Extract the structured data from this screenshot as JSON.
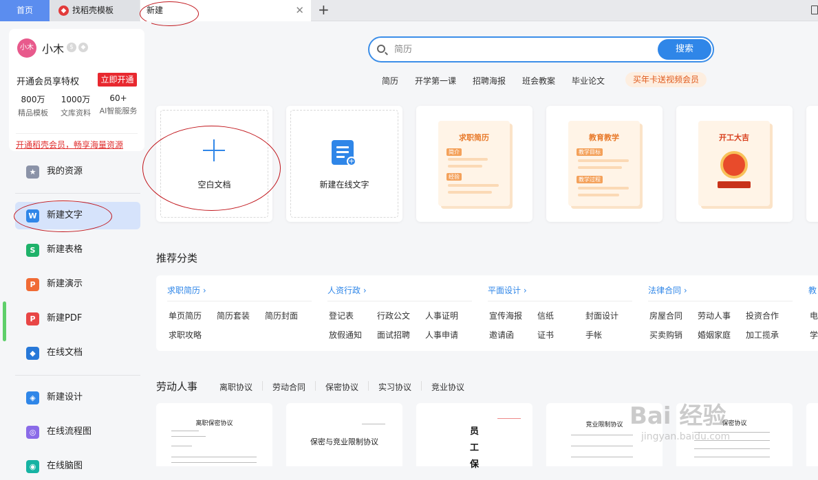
{
  "tabs": {
    "home": "首页",
    "template": "找稻壳模板",
    "new": "新建"
  },
  "user": {
    "avatar_text": "小木",
    "name": "小木",
    "vip_text": "开通会员享特权",
    "vip_button": "立即开通",
    "stats": [
      {
        "value": "800万",
        "label": "精品模板"
      },
      {
        "value": "1000万",
        "label": "文库资料"
      },
      {
        "value": "60+",
        "label": "AI智能服务"
      }
    ],
    "vip_link": "开通稻壳会员，畅享海量资源"
  },
  "sidebar": {
    "items": [
      {
        "label": "我的资源",
        "icon": "star-icon"
      },
      {
        "label": "新建文字",
        "icon": "w-icon"
      },
      {
        "label": "新建表格",
        "icon": "s-icon"
      },
      {
        "label": "新建演示",
        "icon": "p-icon"
      },
      {
        "label": "新建PDF",
        "icon": "pdf-icon"
      },
      {
        "label": "在线文档",
        "icon": "cloud-doc-icon"
      },
      {
        "label": "新建设计",
        "icon": "design-icon"
      },
      {
        "label": "在线流程图",
        "icon": "flow-icon"
      },
      {
        "label": "在线脑图",
        "icon": "mind-icon"
      }
    ],
    "colors": {
      "w": "#2f86e8",
      "s": "#1fb26a",
      "p": "#f06b35",
      "pdf": "#e84646"
    }
  },
  "search": {
    "placeholder": "简历",
    "button": "搜索"
  },
  "hot_tags": [
    "简历",
    "开学第一课",
    "招聘海报",
    "班会教案",
    "毕业论文"
  ],
  "promo": "买年卡送视频会员",
  "templates": [
    {
      "label": "空白文档"
    },
    {
      "label": "新建在线文字"
    },
    {
      "title": "求职简历",
      "tag1": "简介",
      "tag2": "经验"
    },
    {
      "title": "教育教学",
      "tag1": "教学目标",
      "tag2": "教学过程"
    },
    {
      "title": "开工大吉"
    }
  ],
  "recommend_title": "推荐分类",
  "categories": [
    {
      "head": "求职简历 ›",
      "items": [
        "单页简历",
        "简历套装",
        "简历封面",
        "求职攻略"
      ]
    },
    {
      "head": "人资行政 ›",
      "items": [
        "登记表",
        "行政公文",
        "人事证明",
        "放假通知",
        "面试招聘",
        "人事申请"
      ]
    },
    {
      "head": "平面设计 ›",
      "items": [
        "宣传海报",
        "信纸",
        "封面设计",
        "邀请函",
        "证书",
        "手帐"
      ]
    },
    {
      "head": "法律合同 ›",
      "items": [
        "房屋合同",
        "劳动人事",
        "投资合作",
        "买卖购销",
        "婚姻家庭",
        "加工揽承"
      ]
    },
    {
      "head": "教",
      "items": [
        "电",
        "学"
      ]
    }
  ],
  "labor": {
    "title": "劳动人事",
    "tabs": [
      "离职协议",
      "劳动合同",
      "保密协议",
      "实习协议",
      "竞业协议"
    ],
    "docs": [
      "离职保密协议",
      "保密与竞业限制协议",
      "员工保",
      "竞业限制协议",
      "保密协议"
    ]
  },
  "watermark": {
    "main": "Bai 经验",
    "sub": "jingyan.baidu.com"
  }
}
